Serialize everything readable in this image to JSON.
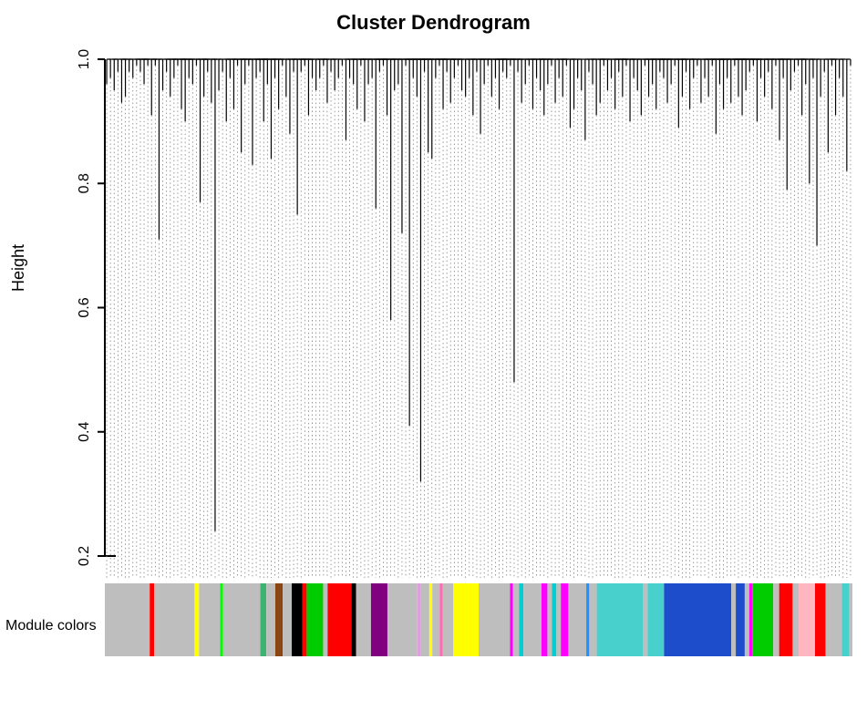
{
  "chart_data": {
    "type": "dendrogram",
    "title": "Cluster Dendrogram",
    "ylabel": "Height",
    "module_track_label": "Module colors",
    "ylim": [
      0.2,
      1.0
    ],
    "yticks": [
      0.2,
      0.4,
      0.6,
      0.8,
      1.0
    ],
    "n_leaves": 200,
    "leaf_heights_estimated": [
      0.96,
      0.97,
      0.95,
      0.98,
      0.93,
      0.94,
      0.98,
      0.97,
      0.99,
      0.98,
      0.96,
      0.99,
      0.91,
      0.99,
      0.71,
      0.95,
      0.98,
      0.94,
      0.97,
      0.99,
      0.92,
      0.9,
      0.97,
      0.96,
      0.99,
      0.77,
      0.94,
      0.98,
      0.93,
      0.24,
      0.95,
      0.98,
      0.9,
      0.97,
      0.92,
      0.99,
      0.85,
      0.96,
      0.99,
      0.83,
      0.97,
      0.98,
      0.9,
      0.96,
      0.84,
      0.97,
      0.92,
      0.99,
      0.94,
      0.88,
      0.98,
      0.75,
      0.98,
      0.99,
      0.91,
      0.97,
      0.95,
      0.97,
      0.99,
      0.93,
      0.98,
      0.95,
      0.97,
      0.99,
      0.87,
      0.97,
      0.96,
      0.92,
      0.99,
      0.9,
      0.96,
      0.97,
      0.76,
      0.98,
      0.99,
      0.91,
      0.58,
      0.95,
      0.96,
      0.72,
      0.99,
      0.41,
      0.97,
      0.94,
      0.32,
      0.98,
      0.85,
      0.84,
      0.97,
      0.99,
      0.92,
      0.98,
      0.93,
      0.97,
      0.99,
      0.95,
      0.94,
      0.97,
      0.91,
      0.98,
      0.88,
      0.96,
      0.99,
      0.94,
      0.97,
      0.92,
      0.98,
      0.97,
      0.99,
      0.48,
      0.98,
      0.93,
      0.96,
      0.99,
      0.92,
      0.97,
      0.95,
      0.91,
      0.96,
      0.99,
      0.93,
      0.97,
      0.94,
      0.99,
      0.89,
      0.92,
      0.97,
      0.95,
      0.87,
      0.98,
      0.96,
      0.91,
      0.93,
      0.99,
      0.95,
      0.97,
      0.92,
      0.98,
      0.94,
      0.99,
      0.9,
      0.97,
      0.95,
      0.91,
      0.99,
      0.94,
      0.96,
      0.92,
      0.98,
      0.97,
      0.93,
      0.96,
      0.99,
      0.89,
      0.94,
      0.98,
      0.92,
      0.97,
      0.99,
      0.93,
      0.97,
      0.94,
      0.99,
      0.88,
      0.96,
      0.92,
      0.97,
      0.93,
      0.99,
      0.94,
      0.91,
      0.95,
      0.98,
      0.99,
      0.9,
      0.97,
      0.94,
      0.98,
      0.92,
      0.99,
      0.87,
      0.97,
      0.79,
      0.95,
      0.98,
      0.99,
      0.91,
      0.96,
      0.8,
      0.97,
      0.7,
      0.94,
      0.98,
      0.85,
      0.99,
      0.91,
      0.97,
      0.94,
      0.82,
      0.99
    ],
    "merge_level_heights_estimated": [
      1.0,
      0.995,
      0.99,
      0.985,
      0.982,
      0.98,
      0.978
    ],
    "module_colors_track": [
      {
        "color": "#BEBEBE",
        "width": 0.06
      },
      {
        "color": "#FF0000",
        "width": 0.006
      },
      {
        "color": "#BEBEBE",
        "width": 0.054
      },
      {
        "color": "#FFFF00",
        "width": 0.006
      },
      {
        "color": "#BEBEBE",
        "width": 0.028
      },
      {
        "color": "#00FF00",
        "width": 0.004
      },
      {
        "color": "#BEBEBE",
        "width": 0.05
      },
      {
        "color": "#3CB371",
        "width": 0.008
      },
      {
        "color": "#BEBEBE",
        "width": 0.012
      },
      {
        "color": "#8B4513",
        "width": 0.01
      },
      {
        "color": "#BEBEBE",
        "width": 0.012
      },
      {
        "color": "#000000",
        "width": 0.014
      },
      {
        "color": "#FF0000",
        "width": 0.006
      },
      {
        "color": "#00CC00",
        "width": 0.022
      },
      {
        "color": "#BEBEBE",
        "width": 0.006
      },
      {
        "color": "#FF0000",
        "width": 0.032
      },
      {
        "color": "#000000",
        "width": 0.006
      },
      {
        "color": "#BEBEBE",
        "width": 0.02
      },
      {
        "color": "#800080",
        "width": 0.022
      },
      {
        "color": "#BEBEBE",
        "width": 0.04
      },
      {
        "color": "#DDA0DD",
        "width": 0.004
      },
      {
        "color": "#BEBEBE",
        "width": 0.012
      },
      {
        "color": "#FFFF00",
        "width": 0.004
      },
      {
        "color": "#BEBEBE",
        "width": 0.01
      },
      {
        "color": "#FF69B4",
        "width": 0.004
      },
      {
        "color": "#BEBEBE",
        "width": 0.014
      },
      {
        "color": "#FFFF00",
        "width": 0.034
      },
      {
        "color": "#BEBEBE",
        "width": 0.042
      },
      {
        "color": "#FF00FF",
        "width": 0.004
      },
      {
        "color": "#BEBEBE",
        "width": 0.008
      },
      {
        "color": "#00CED1",
        "width": 0.006
      },
      {
        "color": "#BEBEBE",
        "width": 0.024
      },
      {
        "color": "#FF00FF",
        "width": 0.008
      },
      {
        "color": "#BEBEBE",
        "width": 0.006
      },
      {
        "color": "#00CED1",
        "width": 0.006
      },
      {
        "color": "#BEBEBE",
        "width": 0.006
      },
      {
        "color": "#FF00FF",
        "width": 0.01
      },
      {
        "color": "#BEBEBE",
        "width": 0.024
      },
      {
        "color": "#1E90FF",
        "width": 0.004
      },
      {
        "color": "#BEBEBE",
        "width": 0.01
      },
      {
        "color": "#48D1CC",
        "width": 0.062
      },
      {
        "color": "#BEBEBE",
        "width": 0.006
      },
      {
        "color": "#48D1CC",
        "width": 0.022
      },
      {
        "color": "#1E4DCC",
        "width": 0.09
      },
      {
        "color": "#BEBEBE",
        "width": 0.006
      },
      {
        "color": "#1E4DCC",
        "width": 0.012
      },
      {
        "color": "#BEBEBE",
        "width": 0.006
      },
      {
        "color": "#FF00FF",
        "width": 0.004
      },
      {
        "color": "#00CC00",
        "width": 0.028
      },
      {
        "color": "#BEBEBE",
        "width": 0.008
      },
      {
        "color": "#FF0000",
        "width": 0.018
      },
      {
        "color": "#BEBEBE",
        "width": 0.008
      },
      {
        "color": "#FFB6C1",
        "width": 0.022
      },
      {
        "color": "#FF0000",
        "width": 0.014
      },
      {
        "color": "#BEBEBE",
        "width": 0.022
      },
      {
        "color": "#48D1CC",
        "width": 0.01
      }
    ],
    "module_palette_legend": {
      "grey": "#BEBEBE",
      "red": "#FF0000",
      "green": "#00CC00",
      "black": "#000000",
      "purple": "#800080",
      "yellow": "#FFFF00",
      "magenta": "#FF00FF",
      "turquoise": "#48D1CC",
      "blue": "#1E4DCC",
      "pink": "#FFB6C1",
      "brown": "#8B4513",
      "plum": "#DDA0DD",
      "darkturquoise": "#00CED1",
      "seagreen": "#3CB371",
      "dodgerblue": "#1E90FF",
      "hotpink": "#FF69B4",
      "lime": "#00FF00"
    }
  }
}
